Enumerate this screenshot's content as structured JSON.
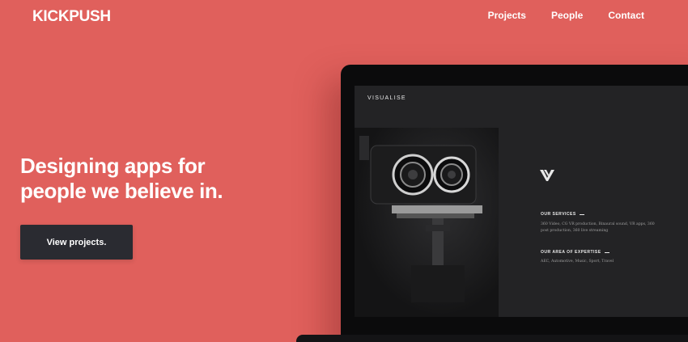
{
  "brand": {
    "logo": "KICKPUSH"
  },
  "nav": [
    {
      "label": "Projects"
    },
    {
      "label": "People"
    },
    {
      "label": "Contact"
    }
  ],
  "hero": {
    "lines": [
      "Designing apps for",
      "people we believe in."
    ],
    "cta_label": "View projects."
  },
  "laptop_screen": {
    "site_title": "VISUALISE",
    "logo_icon": "v-monogram-icon",
    "services_heading": "OUR SERVICES",
    "services_text": "360 Video, CG VR production, Binaural sound, VR apps, 360 post production, 360 live streaming",
    "expertise_heading": "OUR AREA OF EXPERTISE",
    "expertise_text": "AEC, Automotive, Music, Sport, Travel"
  },
  "colors": {
    "background": "#e0605c",
    "button": "#2a2b31",
    "screen": "#232325"
  }
}
